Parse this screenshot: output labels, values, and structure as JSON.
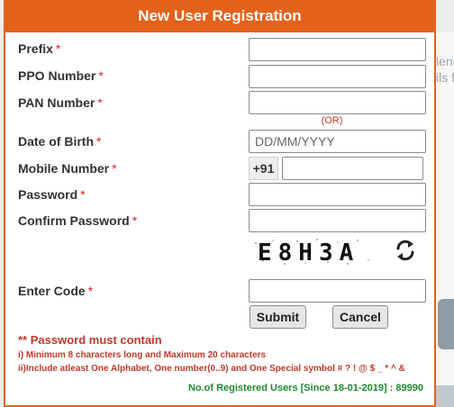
{
  "header": {
    "title": "New User Registration"
  },
  "required_marker": "*",
  "fields": {
    "prefix": {
      "label": "Prefix",
      "value": "",
      "placeholder": ""
    },
    "ppo": {
      "label": "PPO Number",
      "value": "",
      "placeholder": ""
    },
    "pan": {
      "label": "PAN Number",
      "value": "",
      "placeholder": ""
    },
    "or_text": "(OR)",
    "dob": {
      "label": "Date of Birth",
      "value": "",
      "placeholder": "DD/MM/YYYY"
    },
    "mobile": {
      "label": "Mobile Number",
      "country_code": "+91",
      "value": "",
      "placeholder": ""
    },
    "password": {
      "label": "Password",
      "value": "",
      "placeholder": ""
    },
    "confirm_password": {
      "label": "Confirm Password",
      "value": "",
      "placeholder": ""
    },
    "captcha": {
      "text": "E8H3A",
      "refresh_icon": "refresh-icon"
    },
    "code": {
      "label": "Enter Code",
      "value": "",
      "placeholder": ""
    }
  },
  "buttons": {
    "submit": "Submit",
    "cancel": "Cancel"
  },
  "password_rules": {
    "title": "** Password must contain",
    "rule1": "i) Minimum 8 characters long and Maximum 20 characters",
    "rule2": "ii)Include atleast One Alphabet, One number(0..9) and One Special symbol # ? ! @ $ _ * ^ &"
  },
  "footer": {
    "registered_users": "No.of Registered Users [Since 18-01-2019] : 89990"
  },
  "background": {
    "text1": "lenc",
    "text2": "ils f"
  },
  "colors": {
    "accent": "#e2621c",
    "required": "#d62020",
    "note": "#c0392b",
    "footer": "#1e8a2e"
  }
}
